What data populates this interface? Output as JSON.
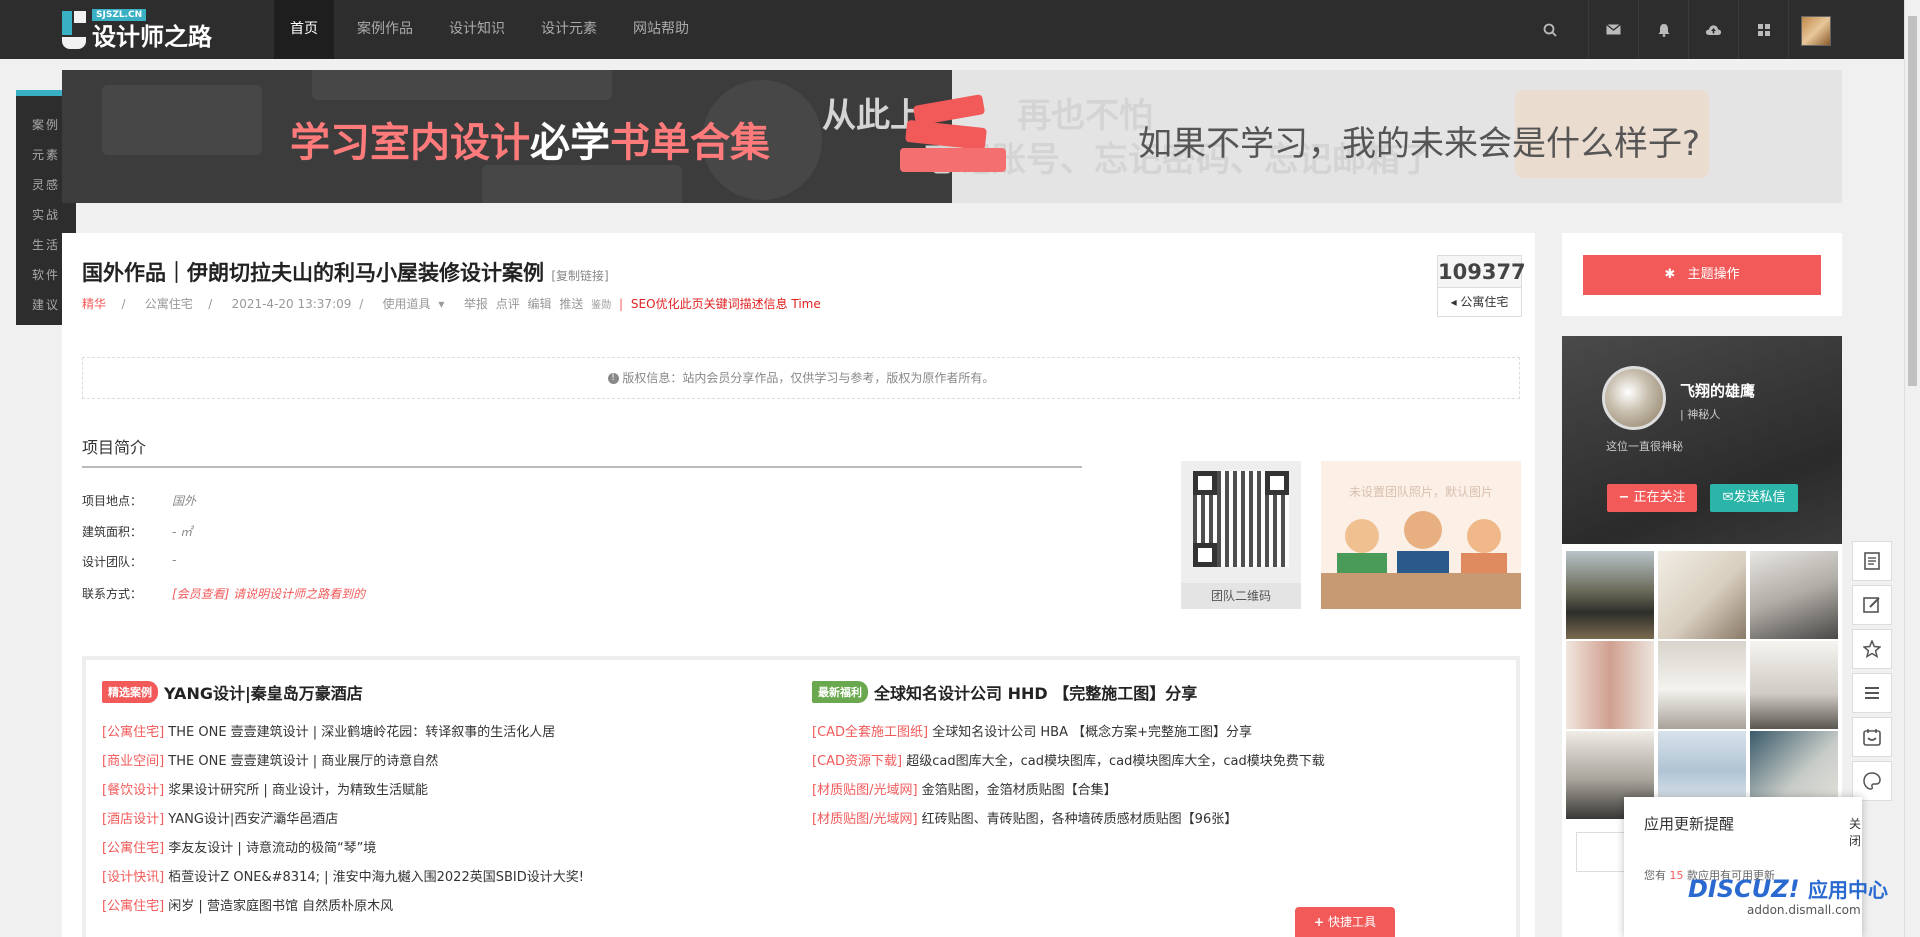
{
  "brand": {
    "sub": "SJSZL.CN",
    "title": "设计师之路"
  },
  "nav": {
    "items": [
      "首页",
      "案例作品",
      "设计知识",
      "设计元素",
      "网站帮助"
    ],
    "active": 0
  },
  "toolbar_icons": [
    "search-icon",
    "mail-icon",
    "bell-icon",
    "cloud-upload-icon",
    "grid-icon"
  ],
  "leftmenu": [
    "案例",
    "元素",
    "灵感",
    "实战",
    "生活",
    "软件",
    "建议"
  ],
  "banner": {
    "title_a": "学习室内设计",
    "title_b": "必学",
    "title_c": "书单合集",
    "right_text": "如果不学习，我的未来会是什么样子?",
    "ghost_1": "从此上",
    "ghost_2": "再也不怕",
    "ghost_3": "忘记账号、忘记密码、忘记邮箱了"
  },
  "article": {
    "title": "国外作品｜伊朗切拉夫山的利马小屋装修设计案例",
    "copy_link": "[复制链接]",
    "tag": "精华",
    "category": "公寓住宅",
    "date": "2021-4-20 13:37:09",
    "use_tool": "使用道具",
    "actions": [
      "举报",
      "点评",
      "编辑",
      "推送",
      "鉴勋"
    ],
    "seo": "SEO优化此页关键词描述信息 Time",
    "views": "109377",
    "view_cat": "公寓住宅",
    "copyright": "版权信息：站内会员分享作品，仅供学习与参考，版权为原作者所有。"
  },
  "intro": {
    "title": "项目简介",
    "fields": [
      {
        "label": "项目地点：",
        "value": "国外"
      },
      {
        "label": "建筑面积：",
        "value": "- ㎡"
      },
      {
        "label": "设计团队：",
        "value": "-"
      },
      {
        "label": "联系方式：",
        "value": "[会员查看] 请说明设计师之路看到的"
      }
    ],
    "qr_label": "团队二维码",
    "team_img_text": "未设置团队照片，默认图片"
  },
  "recommend": {
    "left": {
      "tag": "精选案例",
      "title": "YANG设计|秦皇岛万豪酒店",
      "items": [
        {
          "cat": "[公寓住宅]",
          "text": "THE ONE 壹壹建筑设计 | 深业鹤塘岭花园：转译叙事的生活化人居"
        },
        {
          "cat": "[商业空间]",
          "text": "THE ONE 壹壹建筑设计 | 商业展厅的诗意自然"
        },
        {
          "cat": "[餐饮设计]",
          "text": "浆果设计研究所 | 商业设计，为精致生活赋能"
        },
        {
          "cat": "[酒店设计]",
          "text": "YANG设计|西安浐灞华邑酒店"
        },
        {
          "cat": "[公寓住宅]",
          "text": "李友友设计 | 诗意流动的极简“琴”境"
        },
        {
          "cat": "[设计快讯]",
          "text": "栢萱设计Z ONE&#8314; | 淮安中海九樾入围2022英国SBID设计大奖!"
        },
        {
          "cat": "[公寓住宅]",
          "text": "闲岁 | 营造家庭图书馆 自然质朴原木风"
        }
      ]
    },
    "right": {
      "tag": "最新福利",
      "title": "全球知名设计公司 HHD 【完整施工图】分享",
      "items": [
        {
          "cat": "[CAD全套施工图纸]",
          "text": "全球知名设计公司 HBA 【概念方案+完整施工图】分享"
        },
        {
          "cat": "[CAD资源下载]",
          "text": "超级cad图库大全，cad模块图库，cad模块图库大全，cad模块免费下载"
        },
        {
          "cat": "[材质贴图/光域网]",
          "text": "金箔贴图，金箔材质贴图【合集】"
        },
        {
          "cat": "[材质贴图/光域网]",
          "text": "红砖贴图、青砖贴图，各种墙砖质感材质贴图【96张】"
        }
      ]
    },
    "quick_tool": "快捷工具"
  },
  "sidebar": {
    "theme_button": "主题操作",
    "user": {
      "name": "飞翔的雄鹰",
      "role": "神秘人",
      "bio": "这位一直很神秘",
      "follow": "正在关注",
      "message": "发送私信"
    }
  },
  "float_tools": [
    "document-icon",
    "edit-icon",
    "star-icon",
    "list-icon",
    "calendar-icon",
    "palette-icon"
  ],
  "notice": {
    "title": "应用更新提醒",
    "close": "关闭",
    "body_a": "您有 ",
    "count": "15",
    "body_b": " 款应用有可用更新"
  },
  "discuz": {
    "logo": "DISCUZ!",
    "center": "应用中心",
    "site": "addon.dismall.com"
  },
  "colors": {
    "accent": "#f25a5a",
    "teal": "#3ab0c4",
    "nav_bg": "#2d2d2d",
    "green": "#2bb4a8"
  }
}
